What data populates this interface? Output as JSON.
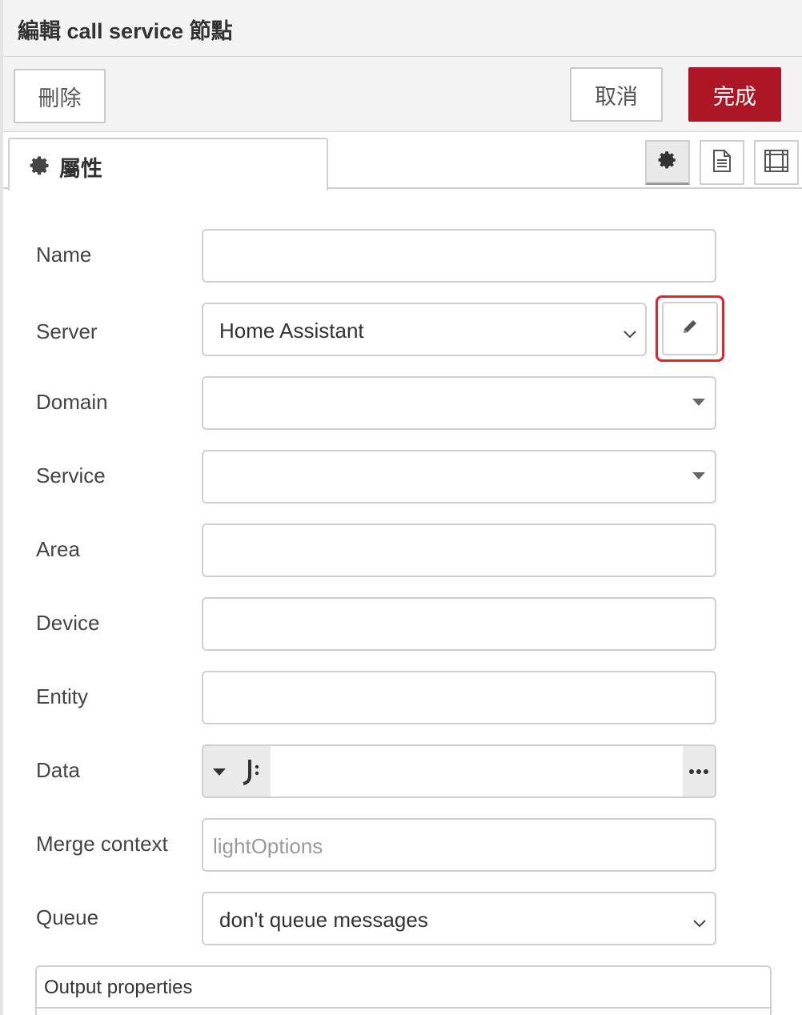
{
  "dialog": {
    "title": "編輯 call service 節點"
  },
  "buttons": {
    "delete": "刪除",
    "cancel": "取消",
    "done": "完成"
  },
  "tabs": [
    {
      "label": "屬性",
      "icon": "gear-icon",
      "active": true
    }
  ],
  "toolbar_icons": [
    "gear-icon",
    "document-icon",
    "appearance-frame-icon"
  ],
  "form": {
    "name": {
      "label": "Name",
      "value": ""
    },
    "server": {
      "label": "Server",
      "value": "Home Assistant",
      "edit_icon": "pencil-icon"
    },
    "domain": {
      "label": "Domain",
      "value": ""
    },
    "service": {
      "label": "Service",
      "value": ""
    },
    "area": {
      "label": "Area",
      "value": ""
    },
    "device": {
      "label": "Device",
      "value": ""
    },
    "entity": {
      "label": "Entity",
      "value": ""
    },
    "data": {
      "label": "Data",
      "type_icon": "json-icon",
      "value": ""
    },
    "merge_context": {
      "label": "Merge context",
      "placeholder": "lightOptions",
      "value": ""
    },
    "queue": {
      "label": "Queue",
      "value": "don't queue messages"
    }
  },
  "output": {
    "label": "Output properties"
  },
  "colors": {
    "primary": "#ad1625",
    "highlight": "#e3232b",
    "border": "#cfcfcf"
  }
}
